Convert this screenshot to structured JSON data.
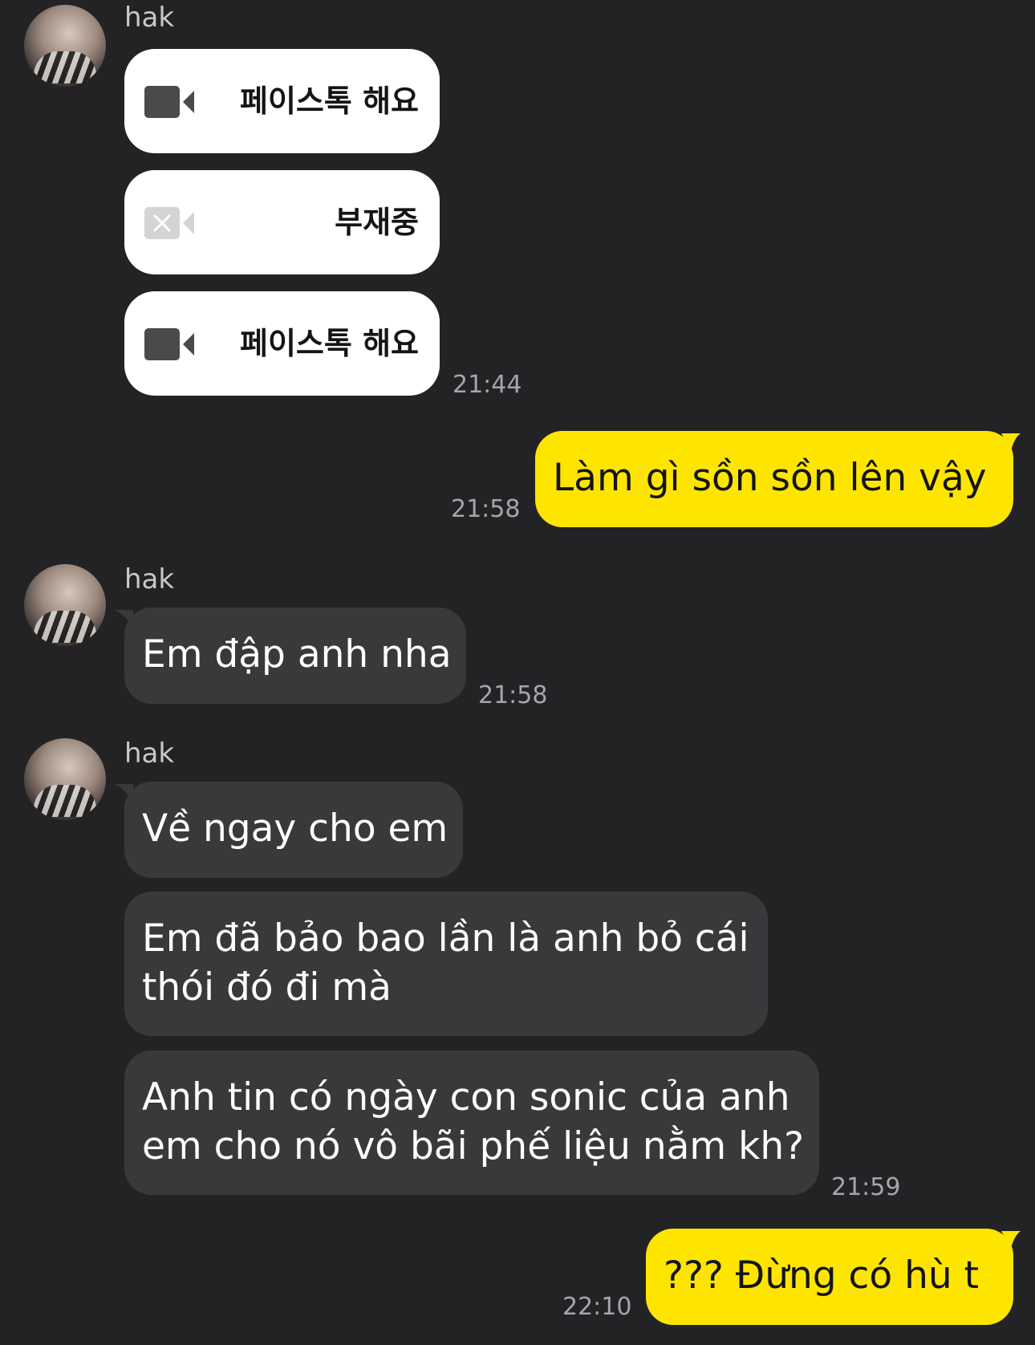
{
  "contact": {
    "name": "hak"
  },
  "calls": [
    {
      "label": "페이스톡 해요",
      "icon": "video-camera-icon"
    },
    {
      "label": "부재중",
      "icon": "video-camera-missed-icon"
    },
    {
      "label": "페이스톡 해요",
      "icon": "video-camera-icon"
    }
  ],
  "times": {
    "t1": "21:44",
    "t2": "21:58",
    "t3": "21:58",
    "t4": "21:59",
    "t5": "22:10"
  },
  "messages": {
    "out1": "Làm gì sồn sồn lên vậy",
    "in1": "Em đập anh nha",
    "in2": "Về ngay cho em",
    "in3_line1": "Em đã bảo bao lần là anh bỏ cái",
    "in3_line2": "thói đó đi mà",
    "in4_line1": "Anh tin có ngày con sonic của anh",
    "in4_line2": "em cho nó vô bãi phế liệu nằm kh?",
    "out2": "??? Đừng có hù t"
  },
  "colors": {
    "background": "#232325",
    "incoming_bubble": "#39393c",
    "outgoing_bubble": "#fde500"
  }
}
